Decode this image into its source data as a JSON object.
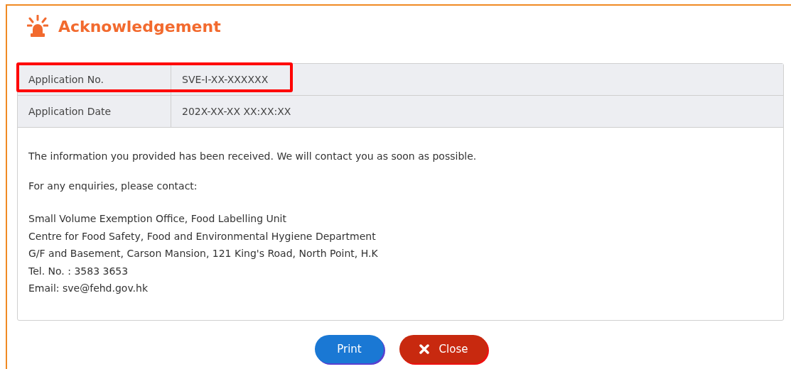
{
  "title": "Acknowledgement",
  "rows": [
    {
      "label": "Application No.",
      "value": "SVE-I-XX-XXXXXX",
      "highlighted": true
    },
    {
      "label": "Application Date",
      "value": "202X-XX-XX XX:XX:XX",
      "highlighted": false
    }
  ],
  "message": "The information you provided has been received. We will contact you as soon as possible.",
  "enquiry": "For any enquiries, please contact:",
  "contact_lines": [
    "Small Volume Exemption Office, Food Labelling Unit",
    "Centre for Food Safety, Food and Environmental Hygiene Department",
    "G/F and Basement, Carson Mansion, 121 King's Road, North Point, H.K",
    "Tel. No. : 3583 3653",
    "Email: sve@fehd.gov.hk"
  ],
  "buttons": [
    {
      "kind": "print",
      "label": "Print"
    },
    {
      "kind": "close",
      "label": "Close"
    }
  ]
}
